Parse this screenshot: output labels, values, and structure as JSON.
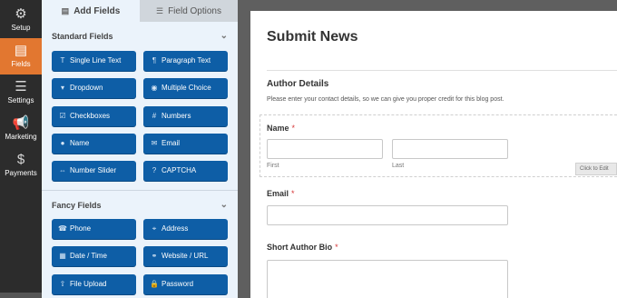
{
  "nav": {
    "items": [
      {
        "label": "Setup",
        "icon": "⚙"
      },
      {
        "label": "Fields",
        "icon": "▤"
      },
      {
        "label": "Settings",
        "icon": "☰"
      },
      {
        "label": "Marketing",
        "icon": "📢"
      },
      {
        "label": "Payments",
        "icon": "$"
      }
    ]
  },
  "panel": {
    "tabs": [
      {
        "label": "Add Fields",
        "icon": "▤"
      },
      {
        "label": "Field Options",
        "icon": "☰"
      }
    ],
    "groups": [
      {
        "title": "Standard Fields",
        "fields": [
          {
            "label": "Single Line Text",
            "icon": "T"
          },
          {
            "label": "Paragraph Text",
            "icon": "¶"
          },
          {
            "label": "Dropdown",
            "icon": "▾"
          },
          {
            "label": "Multiple Choice",
            "icon": "◉"
          },
          {
            "label": "Checkboxes",
            "icon": "☑"
          },
          {
            "label": "Numbers",
            "icon": "#"
          },
          {
            "label": "Name",
            "icon": "●"
          },
          {
            "label": "Email",
            "icon": "✉"
          },
          {
            "label": "Number Slider",
            "icon": "⇔"
          },
          {
            "label": "CAPTCHA",
            "icon": "?"
          }
        ]
      },
      {
        "title": "Fancy Fields",
        "fields": [
          {
            "label": "Phone",
            "icon": "☎"
          },
          {
            "label": "Address",
            "icon": "⌖"
          },
          {
            "label": "Date / Time",
            "icon": "▦"
          },
          {
            "label": "Website / URL",
            "icon": "⚭"
          },
          {
            "label": "File Upload",
            "icon": "⇧"
          },
          {
            "label": "Password",
            "icon": "🔒"
          }
        ]
      }
    ]
  },
  "form": {
    "title": "Submit News",
    "section_title": "Author Details",
    "section_desc": "Please enter your contact details, so we can give you proper credit for this blog post.",
    "name_label": "Name",
    "name_first": "First",
    "name_last": "Last",
    "email_label": "Email",
    "bio_label": "Short Author Bio",
    "required_mark": "*",
    "click_to_edit": "Click to Edit"
  },
  "colors": {
    "nav_bg": "#2c2c2c",
    "nav_active": "#e27730",
    "field_button": "#0e5ea6",
    "panel_bg": "#ebf3fb",
    "required": "#d63638"
  }
}
